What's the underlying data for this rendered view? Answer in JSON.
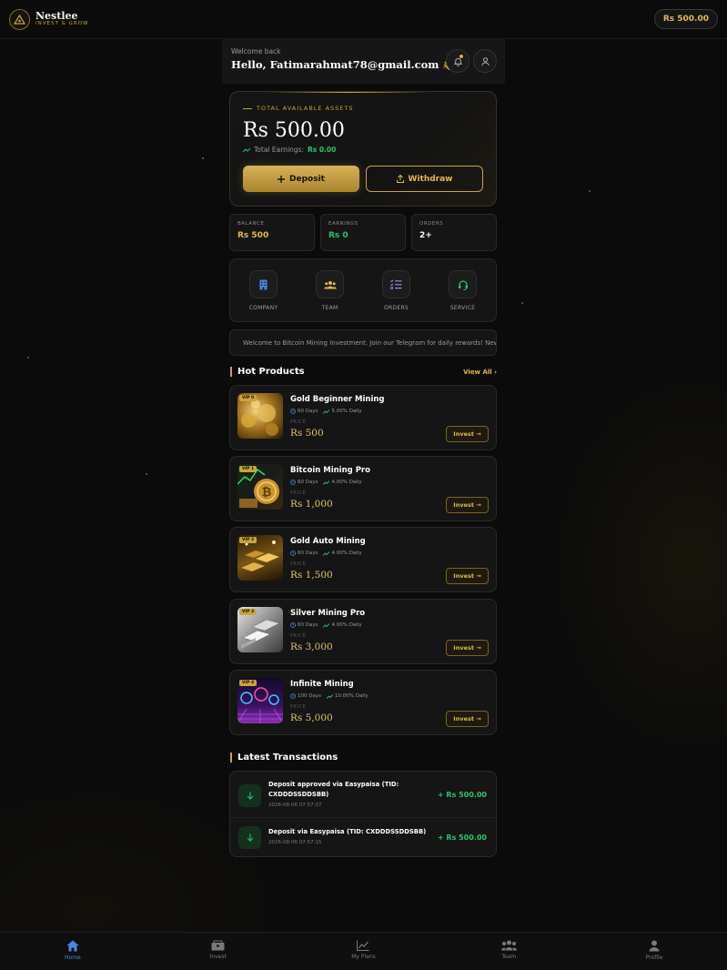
{
  "brand": {
    "name": "Nestlee",
    "tagline": "INVEST & GROW"
  },
  "header": {
    "balance": "Rs 500.00"
  },
  "welcome": {
    "greeting": "Welcome back",
    "name": "Hello, Fatimarahmat78@gmail.com 👋"
  },
  "assets": {
    "label": "TOTAL AVAILABLE ASSETS",
    "value": "Rs 500.00",
    "earnings_label": "Total Earnings:",
    "earnings_value": "Rs 0.00",
    "deposit_label": "Deposit",
    "withdraw_label": "Withdraw"
  },
  "stats": [
    {
      "label": "BALANCE",
      "value": "Rs 500",
      "color": "#e2b94a"
    },
    {
      "label": "EARNINGS",
      "value": "Rs 0",
      "color": "#29c46a"
    },
    {
      "label": "ORDERS",
      "value": "2+",
      "color": "#ffffff"
    }
  ],
  "quick": [
    {
      "label": "COMPANY",
      "icon": "building-icon",
      "color": "#4a86e8"
    },
    {
      "label": "TEAM",
      "icon": "users-icon",
      "color": "#e2b94a"
    },
    {
      "label": "ORDERS",
      "icon": "list-check-icon",
      "color": "#9b8cf0"
    },
    {
      "label": "SERVICE",
      "icon": "headset-icon",
      "color": "#29c46a"
    }
  ],
  "marquee": {
    "text": "Welcome to Bitcoin Mining Investment. Join our Telegram for daily rewards! New"
  },
  "hot": {
    "title": "Hot Products",
    "view_all": "View All ›"
  },
  "products": [
    {
      "vip": "VIP 0",
      "name": "Gold Beginner Mining",
      "days": "60 Days",
      "daily": "5.00% Daily",
      "price_label": "PRICE",
      "price": "Rs 500",
      "invest": "Invest →"
    },
    {
      "vip": "VIP 1",
      "name": "Bitcoin Mining Pro",
      "days": "60 Days",
      "daily": "4.00% Daily",
      "price_label": "PRICE",
      "price": "Rs 1,000",
      "invest": "Invest →"
    },
    {
      "vip": "VIP 2",
      "name": "Gold Auto Mining",
      "days": "60 Days",
      "daily": "4.00% Daily",
      "price_label": "PRICE",
      "price": "Rs 1,500",
      "invest": "Invest →"
    },
    {
      "vip": "VIP 3",
      "name": "Silver Mining Pro",
      "days": "60 Days",
      "daily": "4.00% Daily",
      "price_label": "PRICE",
      "price": "Rs 3,000",
      "invest": "Invest →"
    },
    {
      "vip": "VIP 4",
      "name": "Infinite Mining",
      "days": "100 Days",
      "daily": "10.00% Daily",
      "price_label": "PRICE",
      "price": "Rs 5,000",
      "invest": "Invest →"
    }
  ],
  "transactions_title": "Latest Transactions",
  "transactions": [
    {
      "title": "Deposit approved via Easypaisa (TID: CXDDDSSDDSBB)",
      "time": "2026-08-06 07:57:37",
      "amount": "+ Rs 500.00"
    },
    {
      "title": "Deposit via Easypaisa (TID: CXDDDSSDDSBB)",
      "time": "2026-08-06 07:57:15",
      "amount": "+ Rs 500.00"
    }
  ],
  "nav": [
    {
      "label": "Home",
      "icon": "home-icon"
    },
    {
      "label": "Invest",
      "icon": "box-icon"
    },
    {
      "label": "My Plans",
      "icon": "chart-line-icon"
    },
    {
      "label": "Team",
      "icon": "team-icon"
    },
    {
      "label": "Profile",
      "icon": "user-icon"
    }
  ]
}
